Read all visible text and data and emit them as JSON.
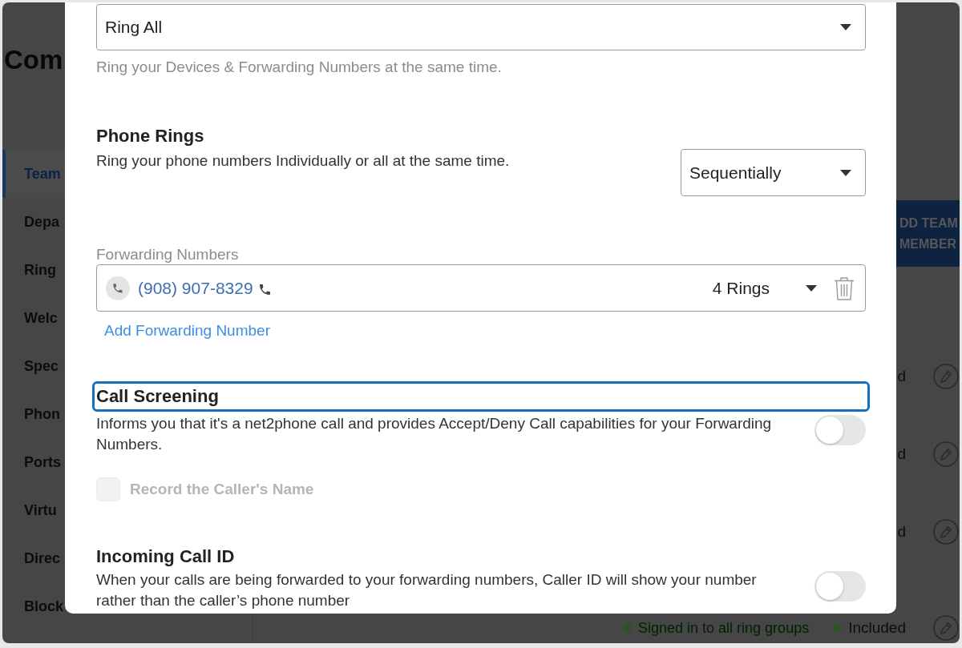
{
  "page": {
    "title": "Com",
    "sidebar": {
      "items": [
        {
          "label": "Team",
          "selected": true
        },
        {
          "label": "Depa",
          "selected": false
        },
        {
          "label": "Ring",
          "selected": false
        },
        {
          "label": "Welc",
          "selected": false
        },
        {
          "label": "Spec",
          "selected": false
        },
        {
          "label": "Phon",
          "selected": false
        },
        {
          "label": "Ports",
          "selected": false
        },
        {
          "label": "Virtu",
          "selected": false
        },
        {
          "label": "Direc",
          "selected": false
        },
        {
          "label": "Block",
          "selected": false
        }
      ]
    },
    "add_button": {
      "label": "DD TEAM MEMBER"
    },
    "rows": [
      {
        "column_4": "d"
      },
      {
        "column_4": "d"
      },
      {
        "column_4": "d"
      },
      {
        "column_3": "Signed in to all ring groups",
        "column_4": "Included"
      }
    ]
  },
  "modal": {
    "ring_strategy": {
      "value": "Ring All",
      "hint": "Ring your Devices & Forwarding Numbers at the same time."
    },
    "phone_rings": {
      "title": "Phone Rings",
      "description": "Ring your phone numbers Individually or all at the same time.",
      "value": "Sequentially"
    },
    "forwarding_numbers": {
      "label": "Forwarding Numbers",
      "entries": [
        {
          "number": "(908) 907-8329",
          "rings": "4 Rings"
        }
      ],
      "add_link": "Add Forwarding Number"
    },
    "call_screening": {
      "title": "Call Screening",
      "focused": true,
      "description": "Informs you that it's a net2phone call and provides Accept/Deny Call capabilities for your Forwarding Numbers.",
      "on": false,
      "record_name": {
        "label": "Record the Caller's Name",
        "checked": false,
        "disabled": true
      }
    },
    "incoming_call_id": {
      "title": "Incoming Call ID",
      "description": "When your calls are being forwarded to your forwarding numbers, Caller ID will show your number rather than the caller’s phone number",
      "on": false
    }
  }
}
